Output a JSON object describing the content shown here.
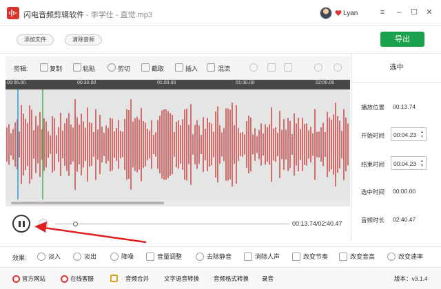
{
  "window": {
    "app_name": "闪电音频剪辑软件",
    "separator": " - ",
    "file_name": "李学仕 - 直觉.mp3",
    "user_name": "Lyan",
    "controls": [
      "settings-icon",
      "minimize-icon",
      "maximize-icon",
      "close-icon"
    ]
  },
  "top": {
    "add_file": "添加文件",
    "clear_audio": "清除音频",
    "export": "导出",
    "export_color": "#1aa14b"
  },
  "toolbar": {
    "label": "剪辑:",
    "tools": [
      "复制",
      "粘贴",
      "剪切",
      "截取",
      "插入",
      "混流"
    ]
  },
  "timeline": {
    "ticks": [
      "00:00.00",
      "00:30.00",
      "01:00.00",
      "01:30.00",
      "02:00.00"
    ]
  },
  "waveform": {
    "color": "#cc2a2a",
    "playhead_color": "#2a9fd6",
    "selection_color": "#3fb34f"
  },
  "selection_panel": {
    "title": "选中",
    "play_position_label": "播放位置",
    "play_position": "00:13.74",
    "start_label": "开始时间",
    "start_value": "00:04.23",
    "end_label": "结束时间",
    "end_value": "00:04.23",
    "selected_label": "选中时间",
    "selected_value": "00:00.00",
    "duration_label": "音频时长",
    "duration_value": "02:40.47"
  },
  "player": {
    "time_readout": "00:13.74/02:40.47",
    "progress": 0.0856
  },
  "effects": {
    "label": "效果:",
    "items": [
      "淡入",
      "淡出",
      "降噪",
      "音量调整",
      "去除静音",
      "消除人声",
      "改变节奏",
      "改变音高",
      "改变速率"
    ]
  },
  "footer": {
    "links": [
      "官方网站",
      "在线客服",
      "音频合并",
      "文字语音转换",
      "音频格式转换",
      "录音"
    ],
    "version": "版本：v3.1.4"
  }
}
